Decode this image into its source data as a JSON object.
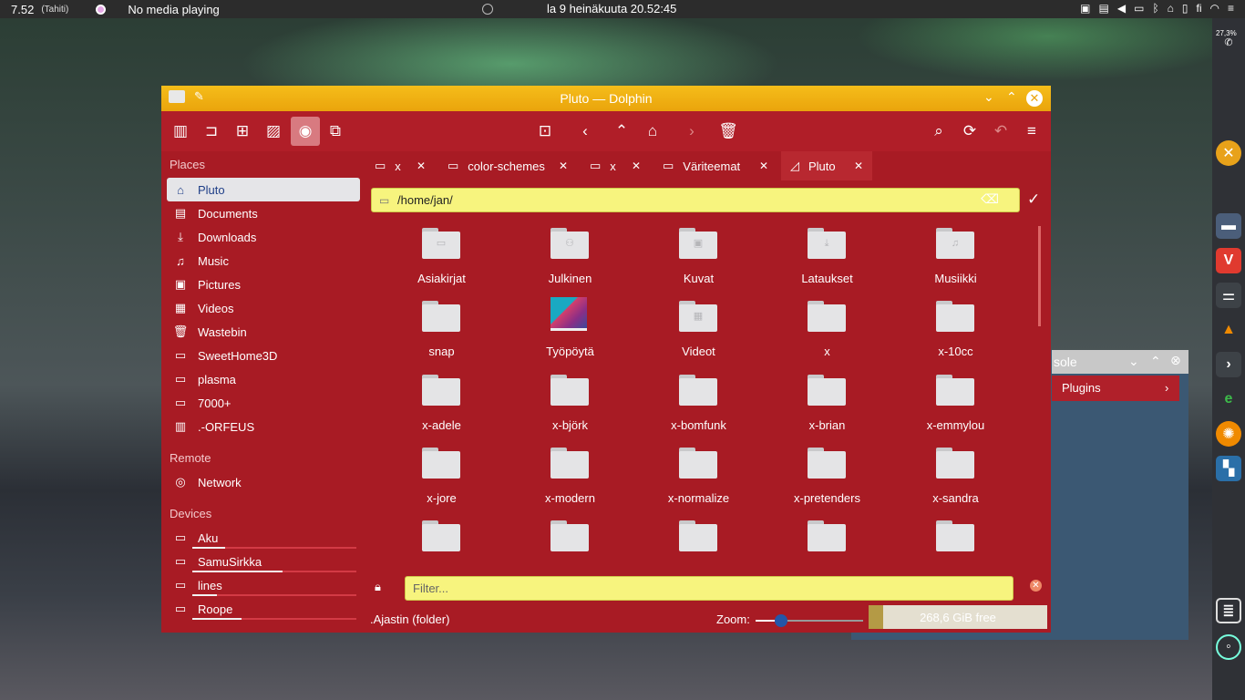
{
  "topbar": {
    "time": "7.52",
    "timezone": "(Tahiti)",
    "media": "No media playing",
    "datetime": "la 9 heinäkuuta 20.52:45",
    "keyboard_layout": "fi"
  },
  "dock": {
    "battery": "27,3%"
  },
  "bg_window": {
    "title_fragment": "sole",
    "tab_label": "Plugins"
  },
  "window": {
    "title": "Pluto — Dolphin"
  },
  "sidebar": {
    "places_heading": "Places",
    "places": [
      {
        "label": "Pluto",
        "icon": "home-icon"
      },
      {
        "label": "Documents",
        "icon": "document-icon"
      },
      {
        "label": "Downloads",
        "icon": "download-icon"
      },
      {
        "label": "Music",
        "icon": "music-icon"
      },
      {
        "label": "Pictures",
        "icon": "picture-icon"
      },
      {
        "label": "Videos",
        "icon": "video-icon"
      },
      {
        "label": "Wastebin",
        "icon": "trash-icon"
      },
      {
        "label": "SweetHome3D",
        "icon": "folder-icon"
      },
      {
        "label": "plasma",
        "icon": "folder-icon"
      },
      {
        "label": "7000+",
        "icon": "folder-icon"
      },
      {
        "label": ".-ORFEUS",
        "icon": "app-icon"
      }
    ],
    "remote_heading": "Remote",
    "remote": [
      {
        "label": "Network",
        "icon": "network-icon"
      }
    ],
    "devices_heading": "Devices",
    "devices": [
      {
        "label": "Aku",
        "usage": 0.2
      },
      {
        "label": "SamuSirkka",
        "usage": 0.55
      },
      {
        "label": "lines",
        "usage": 0.15
      },
      {
        "label": "Roope",
        "usage": 0.3
      }
    ]
  },
  "tabs": [
    {
      "label": "x"
    },
    {
      "label": "color-schemes"
    },
    {
      "label": "x"
    },
    {
      "label": "Väriteemat"
    },
    {
      "label": "Pluto"
    }
  ],
  "location": {
    "path": "/home/jan/"
  },
  "files": [
    {
      "label": "Asiakirjat",
      "glyph": "▭"
    },
    {
      "label": "Julkinen",
      "glyph": "⚇"
    },
    {
      "label": "Kuvat",
      "glyph": "▣"
    },
    {
      "label": "Lataukset",
      "glyph": "⤓"
    },
    {
      "label": "Musiikki",
      "glyph": "♫"
    },
    {
      "label": "snap",
      "glyph": ""
    },
    {
      "label": "Työpöytä",
      "glyph": "desktop"
    },
    {
      "label": "Videot",
      "glyph": "▦"
    },
    {
      "label": "x",
      "glyph": ""
    },
    {
      "label": "x-10cc",
      "glyph": ""
    },
    {
      "label": "x-adele",
      "glyph": ""
    },
    {
      "label": "x-björk",
      "glyph": ""
    },
    {
      "label": "x-bomfunk",
      "glyph": ""
    },
    {
      "label": "x-brian",
      "glyph": ""
    },
    {
      "label": "x-emmylou",
      "glyph": ""
    },
    {
      "label": "x-jore",
      "glyph": ""
    },
    {
      "label": "x-modern",
      "glyph": ""
    },
    {
      "label": "x-normalize",
      "glyph": ""
    },
    {
      "label": "x-pretenders",
      "glyph": ""
    },
    {
      "label": "x-sandra",
      "glyph": ""
    },
    {
      "label": "",
      "glyph": ""
    },
    {
      "label": "",
      "glyph": ""
    },
    {
      "label": "",
      "glyph": ""
    },
    {
      "label": "",
      "glyph": ""
    },
    {
      "label": "",
      "glyph": ""
    }
  ],
  "filter": {
    "placeholder": "Filter..."
  },
  "status": {
    "selection": ".Ajastin (folder)",
    "zoom_label": "Zoom:",
    "zoom_level": 0.24,
    "free_space": "268,6 GiB free",
    "disk_used_fraction": 0.08
  },
  "colors": {
    "window_bg": "#a81b24",
    "titlebar": "#f5bd1a",
    "location_bg": "#f7f47e"
  }
}
